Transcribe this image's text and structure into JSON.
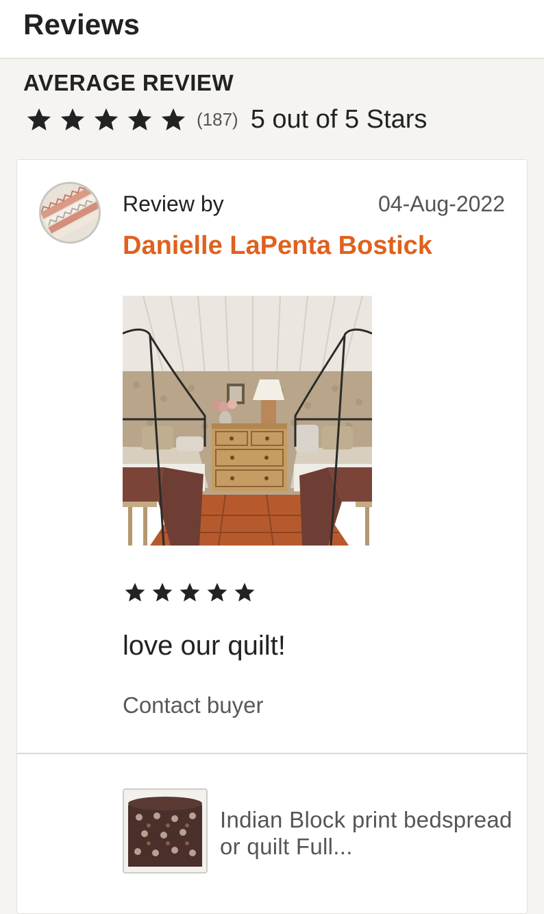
{
  "header": {
    "title": "Reviews"
  },
  "average": {
    "label": "AVERAGE REVIEW",
    "rating": 5,
    "count": "(187)",
    "text": "5 out of 5 Stars"
  },
  "review": {
    "by_label": "Review by",
    "date": "04-Aug-2022",
    "reviewer": "Danielle LaPenta Bostick",
    "rating": 5,
    "text": "love our quilt!",
    "contact_label": "Contact buyer",
    "photo_icon": "bedroom-photo",
    "avatar_icon": "reviewer-avatar"
  },
  "product": {
    "title": "Indian Block print bedspread or quilt Full...",
    "thumb_icon": "quilt-thumbnail"
  },
  "colors": {
    "accent": "#e0611d",
    "text": "#222222",
    "muted": "#595959",
    "background": "#f5f4f1",
    "card": "#ffffff"
  }
}
